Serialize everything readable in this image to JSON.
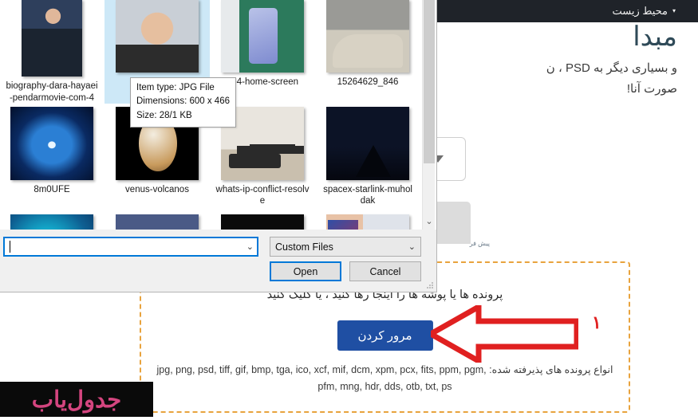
{
  "page": {
    "nav": {
      "item_label": "محیط زیست",
      "caret": "▾"
    },
    "heading": "مبدا",
    "paragraph_line1": "و بسیاری دیگر به PSD ، ن",
    "paragraph_line2": "صورت آنا!",
    "preset_label": "پیش فر",
    "dropzone": {
      "hint": "پرونده ها یا پوشه ها را اینجا رها کنید ، یا کلیک کنید",
      "browse_label": "مرور کردن",
      "accepted_types_line1": "انواع پرونده های پذیرفته شده: jpg, png, psd, tiff, gif, bmp, tga, ico, xcf, mif, dcm, xpm, pcx, fits,",
      "accepted_types_line2": "ppm, pgm, pfm, mng, hdr, dds, otb, txt, ps"
    },
    "annotation_number": "۱",
    "watermark_text": "جدول‌یاب",
    "colors": {
      "topbar": "#1f2329",
      "heading": "#2f4a58",
      "browse_button": "#1f4fa3",
      "dropzone_border": "#e8a33d",
      "annotation_red": "#e02020",
      "watermark_pink": "#d4457f"
    }
  },
  "dialog": {
    "files": [
      {
        "caption": "biography-dara-hayaei-pendarmovie-com-4",
        "art": "t-person1",
        "shape": "portrait",
        "selected": false
      },
      {
        "caption": "",
        "art": "t-person2",
        "shape": "landscape",
        "selected": true
      },
      {
        "caption": "ui-4-home-screen",
        "art": "t-phone",
        "shape": "landscape",
        "selected": false
      },
      {
        "caption": "15264629_846",
        "art": "t-car",
        "shape": "landscape",
        "selected": false
      },
      {
        "caption": "8m0UFE",
        "art": "t-blue",
        "shape": "landscape",
        "selected": false
      },
      {
        "caption": "venus-volcanos",
        "art": "t-venus",
        "shape": "landscape",
        "selected": false
      },
      {
        "caption": "whats-ip-conflict-resolve",
        "art": "t-router",
        "shape": "landscape",
        "selected": false
      },
      {
        "caption": "spacex-starlink-muholdak",
        "art": "t-starlink",
        "shape": "landscape",
        "selected": false
      },
      {
        "caption": "",
        "art": "t-teal",
        "shape": "landscape",
        "selected": false
      },
      {
        "caption": "",
        "art": "t-dusk",
        "shape": "landscape",
        "selected": false
      },
      {
        "caption": "",
        "art": "t-dark",
        "shape": "landscape",
        "selected": false
      },
      {
        "caption": "",
        "art": "t-hands",
        "shape": "landscape",
        "selected": false
      }
    ],
    "tooltip": {
      "item_type": "Item type: JPG File",
      "dimensions": "Dimensions: 600 x 466",
      "size": "Size: 28/1 KB"
    },
    "filename_value": "",
    "filename_caret": "⌄",
    "filter_value": "Custom Files",
    "filter_caret": "⌄",
    "open_label": "Open",
    "cancel_label": "Cancel",
    "scroll_down_glyph": "⌄",
    "accent_color": "#0078d7"
  }
}
